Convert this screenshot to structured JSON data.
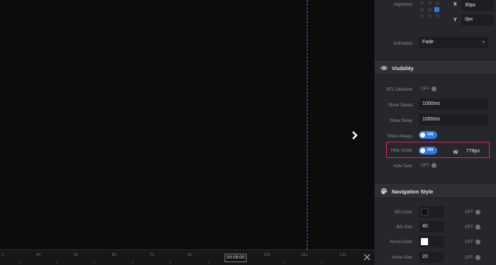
{
  "canvas": {
    "guide_color": "#3b7bd6"
  },
  "timeline": {
    "ticks": [
      "s",
      "4s",
      "5s",
      "6s",
      "7s",
      "8s",
      "10s",
      "11s",
      "12s"
    ],
    "current_time": "00:09:00"
  },
  "panel": {
    "alignment": {
      "label": "Alignment",
      "x_label": "X",
      "x_value": "30px",
      "y_label": "Y",
      "y_value": "0px"
    },
    "animation": {
      "label": "Animation",
      "value": "Fade"
    },
    "visibility": {
      "title": "Visibility",
      "rtl_direction": {
        "label": "RTL Direction",
        "state": "OFF"
      },
      "show_speed": {
        "label": "Show Speed",
        "value": "1000ms"
      },
      "show_delay": {
        "label": "Show Delay",
        "value": "1000ms"
      },
      "show_always": {
        "label": "Show Always",
        "state": "ON"
      },
      "hide_under": {
        "label": "Hide Under",
        "state": "ON",
        "width_icon_label": "W",
        "value": "778px"
      },
      "hide_over": {
        "label": "Hide Over",
        "state": "OFF"
      }
    },
    "navigation_style": {
      "title": "Navigation Style",
      "bg_color": {
        "label": "BG-Color",
        "color": "#111214",
        "state": "OFF"
      },
      "bg_size": {
        "label": "BG-Size",
        "value": "40",
        "state": "OFF"
      },
      "arrow_color": {
        "label": "Arrow-Color",
        "color": "#ffffff",
        "state": "OFF"
      },
      "arrow_size": {
        "label": "Arrow-Size",
        "value": "20",
        "state": "OFF"
      }
    }
  },
  "colors": {
    "accent": "#2f79e6",
    "highlight": "#e0245e"
  }
}
